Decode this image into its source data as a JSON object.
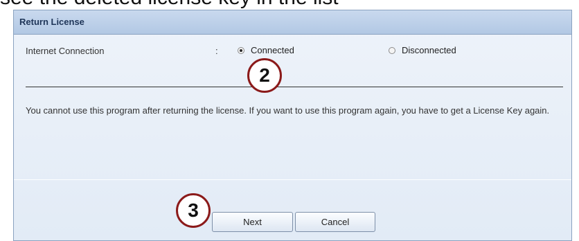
{
  "caption": "see the deleted license key in the list",
  "dialog": {
    "title": "Return License",
    "internet_connection": {
      "label": "Internet Connection",
      "separator": ":",
      "options": [
        {
          "label": "Connected",
          "selected": true
        },
        {
          "label": "Disconnected",
          "selected": false
        }
      ]
    },
    "message": "You cannot use this program after returning the license. If you want to use this program again, you have to get a License Key again.",
    "buttons": {
      "next": "Next",
      "cancel": "Cancel"
    }
  },
  "step_markers": {
    "step2": "2",
    "step3": "3",
    "color": "#8b1a1a"
  }
}
